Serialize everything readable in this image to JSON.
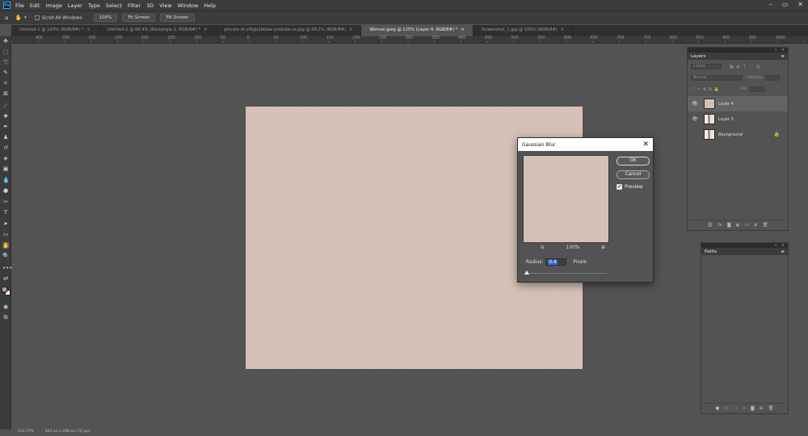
{
  "app": {
    "logo_text": "Ps"
  },
  "menu": [
    "File",
    "Edit",
    "Image",
    "Layer",
    "Type",
    "Select",
    "Filter",
    "3D",
    "View",
    "Window",
    "Help"
  ],
  "window_controls": [
    "–",
    "▭",
    "✕"
  ],
  "options_bar": {
    "scroll_all_windows": "Scroll All Windows",
    "zoom_100": "100%",
    "fit_screen": "Fit Screen",
    "fill_screen": "Fill Screen"
  },
  "tabs": [
    {
      "label": "Untitled-1 @ 103% (RGB/8#) *",
      "active": false
    },
    {
      "label": "Untitled-2 @ 68.4% (Rectangle 1, RGB/8#) *",
      "active": false
    },
    {
      "label": "private-id-yt0gb2btlaw-youtube-ss.jpg @ 68.2% (RGB/8#)",
      "active": false
    },
    {
      "label": "Woman.jpeg @ 125% (Layer 4, RGB/8#) *",
      "active": true
    },
    {
      "label": "Screenshot_1.jpg @ 100% (RGB/8#)",
      "active": false
    }
  ],
  "ruler_labels": [
    "400",
    "350",
    "300",
    "250",
    "200",
    "150",
    "100",
    "50",
    "0",
    "50",
    "100",
    "150",
    "200",
    "250",
    "300",
    "350",
    "400",
    "450",
    "500",
    "550",
    "600",
    "650",
    "700",
    "750",
    "800",
    "850",
    "900",
    "950",
    "1000"
  ],
  "status_bar": {
    "zoom": "124.57%",
    "doc_size": "841 px x 498 px (72 ppi)"
  },
  "layers_panel": {
    "title": "Layers",
    "search_placeholder": "Kind",
    "blend_mode": "Normal",
    "opacity_label": "Opacity:",
    "fill_label": "Fill:",
    "layers": [
      {
        "name": "Layer 4",
        "visible": true,
        "selected": true,
        "thumb": "flat"
      },
      {
        "name": "Layer 3",
        "visible": true,
        "selected": false,
        "thumb": "photo"
      },
      {
        "name": "Background",
        "visible": false,
        "selected": false,
        "thumb": "photo",
        "locked": true
      }
    ],
    "footer_icons": [
      "link-icon",
      "fx-icon",
      "mask-icon",
      "adjustment-icon",
      "group-icon",
      "new-layer-icon",
      "trash-icon"
    ]
  },
  "paths_panel": {
    "title": "Paths"
  },
  "gaussian_blur": {
    "title": "Gaussian Blur",
    "ok_label": "OK",
    "cancel_label": "Cancel",
    "preview_label": "Preview",
    "preview_checked": true,
    "zoom_level": "100%",
    "radius_label": "Radius:",
    "radius_value": "0.4",
    "unit_label": "Pixels",
    "slider_value": 0.4
  },
  "colors": {
    "canvas": "#d5c0b5",
    "foreground_swatch": "#c49b8e",
    "background_swatch": "#ffffff",
    "ui_dark": "#3c3c3c",
    "workspace": "#535353"
  }
}
